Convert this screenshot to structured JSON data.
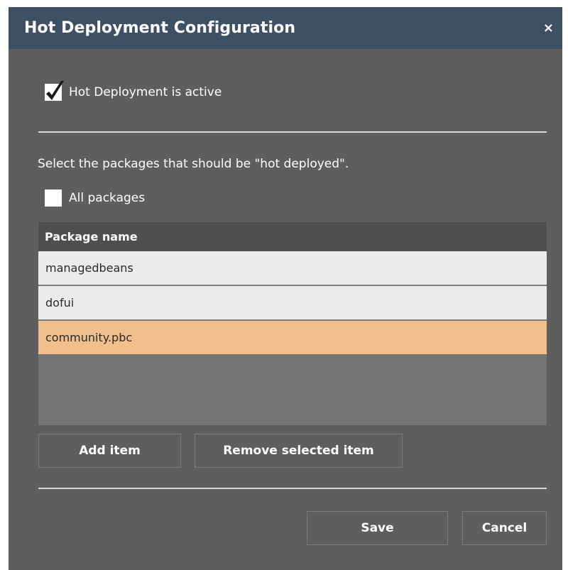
{
  "dialog": {
    "title": "Hot Deployment Configuration",
    "close_label": "×"
  },
  "hot_deployment": {
    "label": "Hot Deployment is active",
    "checked": true
  },
  "packages": {
    "instruction": "Select the packages that should be \"hot deployed\".",
    "all_label": "All packages",
    "all_checked": false,
    "column_header": "Package name",
    "rows": [
      {
        "name": "managedbeans",
        "selected": false
      },
      {
        "name": "dofui",
        "selected": false
      },
      {
        "name": "community.pbc",
        "selected": true
      }
    ],
    "add_label": "Add item",
    "remove_label": "Remove selected item"
  },
  "footer": {
    "save_label": "Save",
    "cancel_label": "Cancel"
  },
  "colors": {
    "titlebar": "#3e5164",
    "body": "#5e5e5e",
    "selected_row": "#f0bf8c"
  }
}
